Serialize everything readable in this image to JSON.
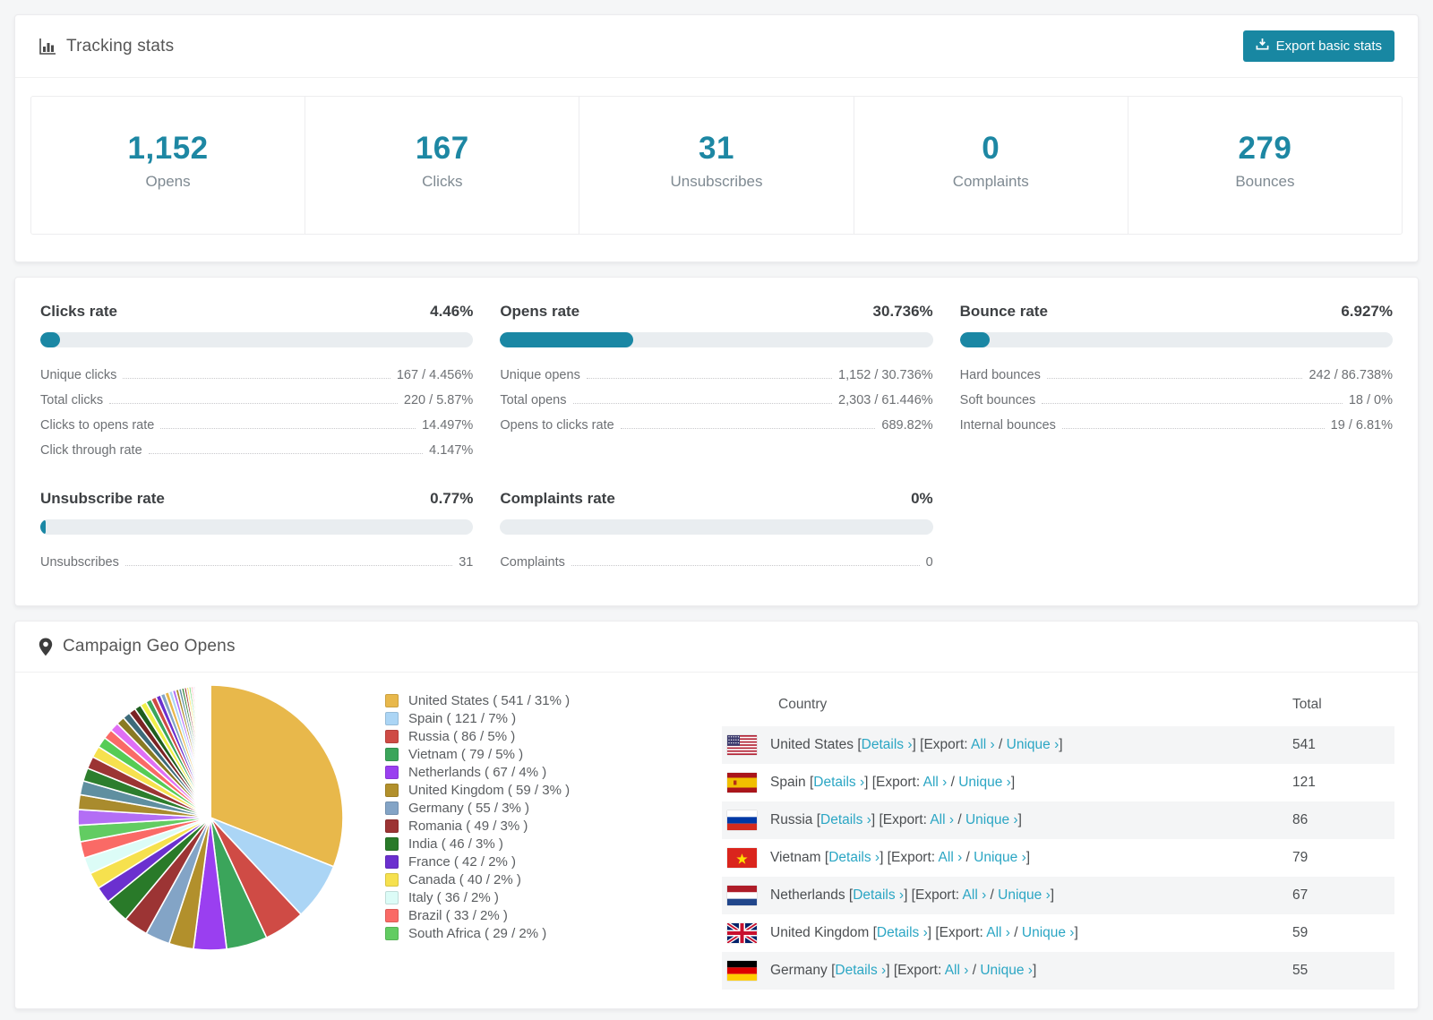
{
  "header": {
    "title": "Tracking stats",
    "export_label": "Export basic stats"
  },
  "summary": [
    {
      "value": "1,152",
      "label": "Opens"
    },
    {
      "value": "167",
      "label": "Clicks"
    },
    {
      "value": "31",
      "label": "Unsubscribes"
    },
    {
      "value": "0",
      "label": "Complaints"
    },
    {
      "value": "279",
      "label": "Bounces"
    }
  ],
  "rates": [
    {
      "title": "Clicks rate",
      "value": "4.46%",
      "percent": 4.46,
      "grid_col": 1,
      "rows": [
        {
          "label": "Unique clicks",
          "value": "167 / 4.456%"
        },
        {
          "label": "Total clicks",
          "value": "220 / 5.87%"
        },
        {
          "label": "Clicks to opens rate",
          "value": "14.497%"
        },
        {
          "label": "Click through rate",
          "value": "4.147%"
        }
      ]
    },
    {
      "title": "Opens rate",
      "value": "30.736%",
      "percent": 30.736,
      "grid_col": 2,
      "rows": [
        {
          "label": "Unique opens",
          "value": "1,152 / 30.736%"
        },
        {
          "label": "Total opens",
          "value": "2,303 / 61.446%"
        },
        {
          "label": "Opens to clicks rate",
          "value": "689.82%"
        }
      ]
    },
    {
      "title": "Bounce rate",
      "value": "6.927%",
      "percent": 6.927,
      "grid_col": 3,
      "rows": [
        {
          "label": "Hard bounces",
          "value": "242 / 86.738%"
        },
        {
          "label": "Soft bounces",
          "value": "18 / 0%"
        },
        {
          "label": "Internal bounces",
          "value": "19 / 6.81%"
        }
      ]
    },
    {
      "title": "Unsubscribe rate",
      "value": "0.77%",
      "percent": 0.77,
      "grid_col": 1,
      "rows": [
        {
          "label": "Unsubscribes",
          "value": "31"
        }
      ]
    },
    {
      "title": "Complaints rate",
      "value": "0%",
      "percent": 0,
      "grid_col": 2,
      "rows": [
        {
          "label": "Complaints",
          "value": "0"
        }
      ]
    }
  ],
  "geo": {
    "title": "Campaign Geo Opens",
    "table": {
      "headers": [
        "Country",
        "Total"
      ],
      "labels": {
        "details": "Details",
        "export_prefix": "Export:",
        "all": "All",
        "unique": "Unique",
        "chevron": "›"
      },
      "rows": [
        {
          "country": "United States",
          "total": "541",
          "flag": "us"
        },
        {
          "country": "Spain",
          "total": "121",
          "flag": "es"
        },
        {
          "country": "Russia",
          "total": "86",
          "flag": "ru"
        },
        {
          "country": "Vietnam",
          "total": "79",
          "flag": "vn"
        },
        {
          "country": "Netherlands",
          "total": "67",
          "flag": "nl"
        },
        {
          "country": "United Kingdom",
          "total": "59",
          "flag": "gb"
        },
        {
          "country": "Germany",
          "total": "55",
          "flag": "de"
        }
      ]
    }
  },
  "chart_data": {
    "type": "pie",
    "title": "Campaign Geo Opens",
    "legend_position": "right",
    "labels": [
      "United States",
      "Spain",
      "Russia",
      "Vietnam",
      "Netherlands",
      "United Kingdom",
      "Germany",
      "Romania",
      "India",
      "France",
      "Canada",
      "Italy",
      "Brazil",
      "South Africa"
    ],
    "values": [
      541,
      121,
      86,
      79,
      67,
      59,
      55,
      49,
      46,
      42,
      40,
      36,
      33,
      29
    ],
    "percents": [
      31,
      7,
      5,
      5,
      4,
      3,
      3,
      3,
      3,
      2,
      2,
      2,
      2,
      2
    ],
    "colors": [
      "#e8b84b",
      "#abd5f5",
      "#cf4b45",
      "#3ba55b",
      "#9a3ff0",
      "#b2902c",
      "#83a4c6",
      "#9c3434",
      "#297a29",
      "#6b30cf",
      "#f6e14e",
      "#dcfcf7",
      "#fa6a66",
      "#62cc62"
    ],
    "other_slices": [
      1.9,
      1.8,
      1.7,
      1.6,
      1.5,
      1.4,
      1.3,
      1.2,
      1.1,
      1.0,
      0.9,
      0.85,
      0.8,
      0.75,
      0.7,
      0.65,
      0.6,
      0.55,
      0.5,
      0.45,
      0.4,
      0.38,
      0.35,
      0.32,
      0.3,
      0.28,
      0.25,
      0.22,
      0.2,
      0.18,
      0.16,
      0.15,
      0.14,
      0.13,
      0.12,
      0.11,
      0.1,
      0.1,
      0.1,
      0.1,
      0.09,
      0.08,
      0.07,
      0.06,
      0.05,
      0.05,
      0.05,
      0.04,
      0.04,
      0.03
    ],
    "other_colors": [
      "#b36ef5",
      "#a98b2d",
      "#5f8fa0",
      "#2d7e2d",
      "#9c3434",
      "#f6e14e",
      "#55cc55",
      "#fa6a66",
      "#e06ff5",
      "#8a7a22",
      "#3d6b7a",
      "#7a2424",
      "#1e5e1e",
      "#f0f04a",
      "#3ba55b",
      "#cf4b45",
      "#6b30cf",
      "#83a4c6",
      "#e8b84b",
      "#abd5f5"
    ]
  },
  "colors": {
    "accent": "#1887a2",
    "link": "#2ba6c4",
    "stat_number": "#1d87a3",
    "bar_track": "#e9edf0"
  }
}
